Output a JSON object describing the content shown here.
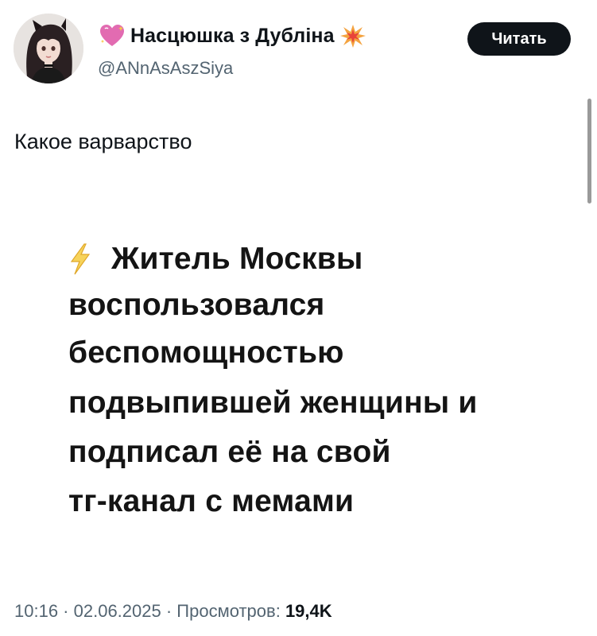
{
  "author": {
    "display_name": "Насцюшка з Дубліна",
    "handle": "@ANnAsAszSiya",
    "name_prefix_icon": "sparkling-heart-icon",
    "name_suffix_icon": "collision-icon"
  },
  "follow_button": {
    "label": "Читать"
  },
  "tweet": {
    "text": "Какое варварство"
  },
  "media": {
    "icon": "lightning-icon",
    "lines": [
      "Житель Москвы",
      "воспользовался",
      "беспомощностью",
      "подвыпившей женщины и",
      "подписал её на свой",
      "тг-канал с мемами"
    ]
  },
  "meta": {
    "time": "10:16",
    "separator": " · ",
    "date": "02.06.2025",
    "views_label": "Просмотров:",
    "views_count": "19,4K"
  },
  "colors": {
    "text_primary": "#0f1419",
    "text_secondary": "#536471",
    "button_bg": "#0f1419",
    "button_text": "#ffffff"
  }
}
